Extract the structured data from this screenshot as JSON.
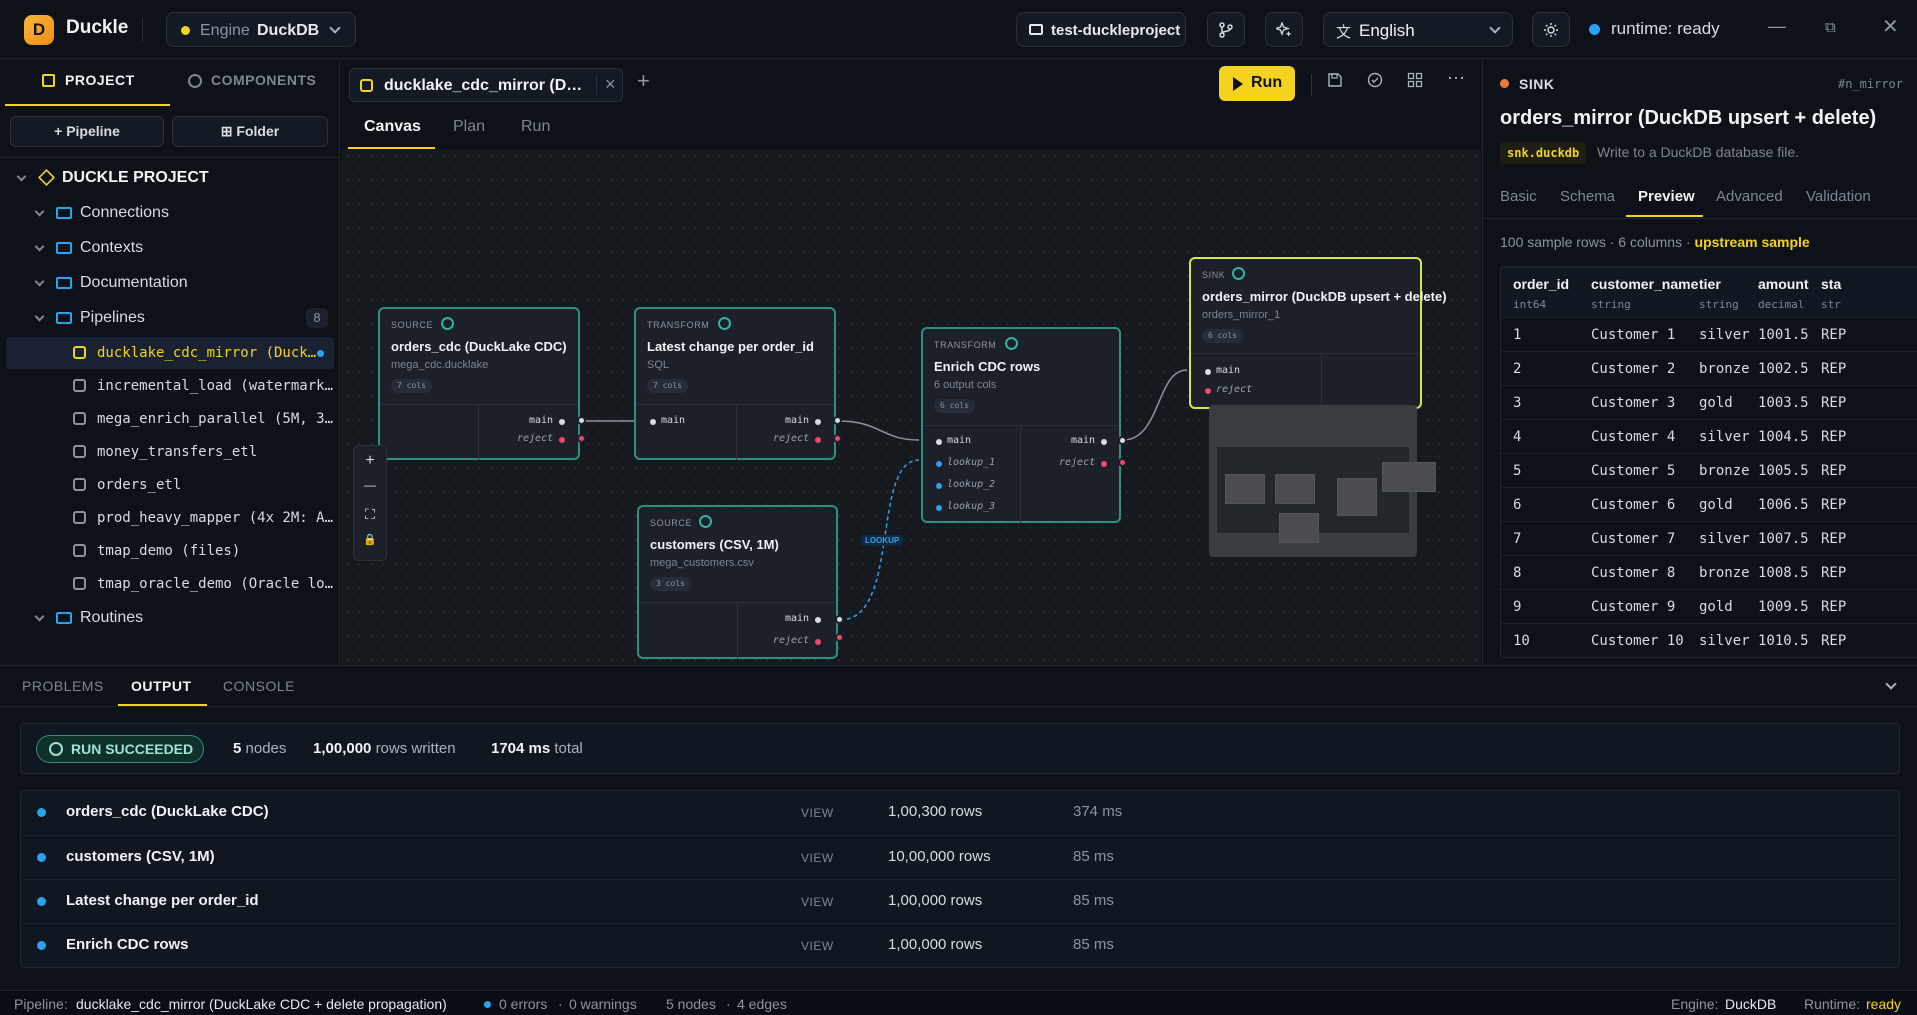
{
  "app": {
    "name": "Duckle",
    "logo_letter": "D"
  },
  "topbar": {
    "engine_label": "Engine",
    "engine_value": "DuckDB",
    "project_name": "test-duckleproject",
    "language": "English",
    "runtime": "runtime: ready"
  },
  "sidebar": {
    "tabs": [
      "PROJECT",
      "COMPONENTS"
    ],
    "buttons": [
      "Pipeline",
      "Folder"
    ],
    "root": "DUCKLE PROJECT",
    "folders": [
      "Connections",
      "Contexts",
      "Documentation",
      "Pipelines",
      "Routines"
    ],
    "pipelines_count": "8",
    "pipelines": [
      "ducklake_cdc_mirror (Duck…",
      "incremental_load (watermark…",
      "mega_enrich_parallel (5M, 3…",
      "money_transfers_etl",
      "orders_etl",
      "prod_heavy_mapper (4x 2M: A…",
      "tmap_demo (files)",
      "tmap_oracle_demo (Oracle lo…"
    ]
  },
  "editor": {
    "file_tab": "ducklake_cdc_mirror (D…",
    "run_label": "Run",
    "tabs": [
      "Canvas",
      "Plan",
      "Run"
    ]
  },
  "canvas": {
    "nodes": [
      {
        "kind": "SOURCE",
        "title": "orders_cdc (DuckLake CDC)",
        "sub": "mega_cdc.ducklake",
        "chip": "7 cols"
      },
      {
        "kind": "TRANSFORM",
        "title": "Latest change per order_id",
        "sub": "SQL",
        "chip": "7 cols"
      },
      {
        "kind": "TRANSFORM",
        "title": "Enrich CDC rows",
        "sub": "6 output cols",
        "chip": "6 cols"
      },
      {
        "kind": "SINK",
        "title": "orders_mirror (DuckDB upsert + delete)",
        "sub": "orders_mirror_1",
        "chip": "6 cols"
      },
      {
        "kind": "SOURCE",
        "title": "customers (CSV, 1M)",
        "sub": "mega_customers.csv",
        "chip": "3 cols"
      }
    ],
    "ports": {
      "main": "main",
      "reject": "reject",
      "lookups": [
        "lookup_1",
        "lookup_2",
        "lookup_3"
      ]
    },
    "edge_label": "LOOKUP",
    "zoom": [
      "+",
      "—",
      "⛶",
      "🔒"
    ]
  },
  "inspector": {
    "kind": "SINK",
    "id": "#n_mirror",
    "title": "orders_mirror (DuckDB upsert + delete)",
    "chip": "snk.duckdb",
    "desc": "Write to a DuckDB database file.",
    "tabs": [
      "Basic",
      "Schema",
      "Preview",
      "Advanced",
      "Validation"
    ],
    "meta": "100 sample rows · 6 columns ·",
    "meta_hl": "upstream sample",
    "columns": [
      {
        "name": "order_id",
        "type": "int64"
      },
      {
        "name": "customer_name",
        "type": "string"
      },
      {
        "name": "tier",
        "type": "string"
      },
      {
        "name": "amount",
        "type": "decimal"
      },
      {
        "name": "sta",
        "type": "str"
      }
    ],
    "rows": [
      [
        "1",
        "Customer 1",
        "silver",
        "1001.5",
        "REP"
      ],
      [
        "2",
        "Customer 2",
        "bronze",
        "1002.5",
        "REP"
      ],
      [
        "3",
        "Customer 3",
        "gold",
        "1003.5",
        "REP"
      ],
      [
        "4",
        "Customer 4",
        "silver",
        "1004.5",
        "REP"
      ],
      [
        "5",
        "Customer 5",
        "bronze",
        "1005.5",
        "REP"
      ],
      [
        "6",
        "Customer 6",
        "gold",
        "1006.5",
        "REP"
      ],
      [
        "7",
        "Customer 7",
        "silver",
        "1007.5",
        "REP"
      ],
      [
        "8",
        "Customer 8",
        "bronze",
        "1008.5",
        "REP"
      ],
      [
        "9",
        "Customer 9",
        "gold",
        "1009.5",
        "REP"
      ],
      [
        "10",
        "Customer 10",
        "silver",
        "1010.5",
        "REP"
      ]
    ]
  },
  "bottom": {
    "tabs": [
      "PROBLEMS",
      "OUTPUT",
      "CONSOLE"
    ],
    "status": "RUN SUCCEEDED",
    "nodes_n": "5",
    "nodes_l": "nodes",
    "rows_n": "1,00,000",
    "rows_l": "rows written",
    "ms_n": "1704 ms",
    "ms_l": "total",
    "view": "VIEW",
    "runs": [
      {
        "name": "orders_cdc (DuckLake CDC)",
        "rows": "1,00,300 rows",
        "ms": "374 ms"
      },
      {
        "name": "customers (CSV, 1M)",
        "rows": "10,00,000 rows",
        "ms": "85 ms"
      },
      {
        "name": "Latest change per order_id",
        "rows": "1,00,000 rows",
        "ms": "85 ms"
      },
      {
        "name": "Enrich CDC rows",
        "rows": "1,00,000 rows",
        "ms": "85 ms"
      }
    ]
  },
  "statusbar": {
    "pipeline_l": "Pipeline:",
    "pipeline": "ducklake_cdc_mirror (DuckLake CDC + delete propagation)",
    "errors": "0 errors",
    "warnings": "0 warnings",
    "nodes": "5 nodes",
    "edges": "4 edges",
    "engine_l": "Engine:",
    "engine": "DuckDB",
    "runtime_l": "Runtime:",
    "runtime": "ready"
  },
  "colors": {
    "accent": "#f4d21d",
    "teal": "#2f8f80",
    "sink": "#d4e84a",
    "info": "#29a3f0",
    "reject": "#f0476a"
  }
}
